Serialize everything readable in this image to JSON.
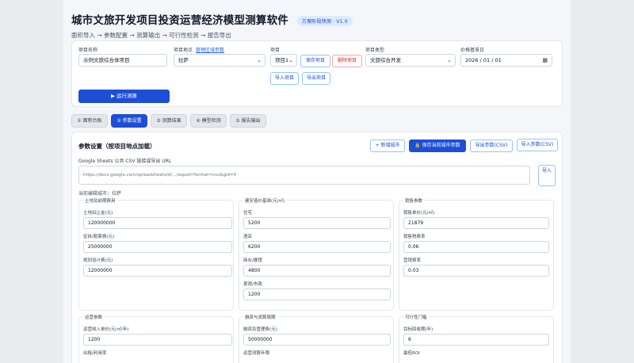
{
  "header": {
    "title": "城市文旅开发项目投资运营经济模型测算软件",
    "version": "方案阶段快测 · V1.0",
    "subtitle": "面积导入 → 参数配置 → 测算输出 → 可行性检测 → 报告导出"
  },
  "form": {
    "project_name_label": "项目名称",
    "project_name_value": "示例文旅综合体项目",
    "location_label": "项目地点",
    "location_link": "管理区域参数",
    "location_value": "拉萨",
    "project_label": "项目",
    "project_value": "项目1",
    "save_project": "保存项目",
    "delete_project": "删除项目",
    "import_project": "导入项目",
    "export_project": "导出项目",
    "type_label": "项目类型",
    "type_value": "文旅综合开发",
    "base_date_label": "价格基准日",
    "base_date_value": "2026 / 01 / 01",
    "run_button": "▶ 运行测算"
  },
  "tabs": [
    {
      "label": "① 面积台账",
      "active": false
    },
    {
      "label": "② 参数设置",
      "active": true
    },
    {
      "label": "③ 测算结果",
      "active": false
    },
    {
      "label": "④ 模型检测",
      "active": false
    },
    {
      "label": "⑤ 报告输出",
      "active": false
    }
  ],
  "params": {
    "section_title": "参数设置（按项目地点加载）",
    "add_city": "+ 新增城市",
    "save_city": "🔒 保存当前城市参数",
    "export_csv": "导出参数(CSV)",
    "import_csv": "导入参数(CSV)",
    "gs_label": "Google Sheets 公共 CSV 链接或导出 URL",
    "gs_placeholder": "https://docs.google.com/spreadsheets/d/.../export?format=csv&gid=0",
    "gs_import": "导入",
    "current_city": "当前编辑城市：拉萨"
  },
  "panels": {
    "land": {
      "legend": "土地及前期费用",
      "f1_label": "土地出让金(元)",
      "f1_value": "120000000",
      "f2_label": "征拆/配套费(元)",
      "f2_value": "25000000",
      "f3_label": "规划设计费(元)",
      "f3_value": "12000000"
    },
    "cost": {
      "legend": "建安造价基准(元/㎡)",
      "f1_label": "住宅",
      "f1_value": "5200",
      "f2_label": "酒店",
      "f2_value": "6200",
      "f3_label": "商业/展馆",
      "f3_value": "4800",
      "f4_label": "景观/市政",
      "f4_value": "1200"
    },
    "sales": {
      "legend": "销售参数",
      "f1_label": "销售单价(元/㎡)",
      "f1_value": "21879",
      "f2_label": "销售税费率",
      "f2_value": "0.06",
      "f3_label": "营销费率",
      "f3_value": "0.03"
    },
    "ops": {
      "legend": "运营参数",
      "f1_label": "运营收入单价(元/㎡/年)",
      "f1_value": "1200",
      "f2_label": "出租/利用率"
    },
    "finance": {
      "legend": "融资与测算周期",
      "f1_label": "融资及管理费(元)",
      "f1_value": "50000000",
      "f2_label": "运营测算年限"
    },
    "feasibility": {
      "legend": "可行性门槛",
      "f1_label": "目标回收期(年)",
      "f1_value": "6",
      "f2_label": "最低ROI"
    }
  }
}
